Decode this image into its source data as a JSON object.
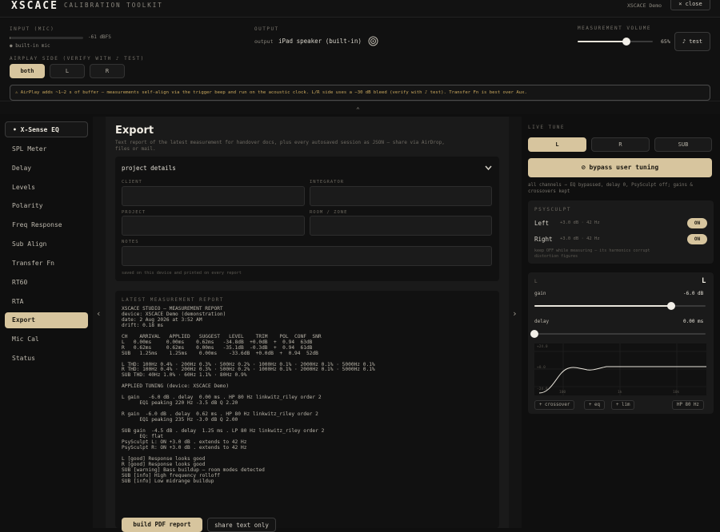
{
  "topbar": {
    "logo": "XSCACE",
    "app_title": "CALIBRATION TOOLKIT",
    "device": "XSCACE Demo",
    "close_label": "× close"
  },
  "input": {
    "label": "INPUT (MIC)",
    "level": "-61 dBFS",
    "level_fraction": 0.01,
    "source": "● built-in mic"
  },
  "output": {
    "label": "OUTPUT",
    "prefix": "output",
    "device": "iPad speaker (built-in)"
  },
  "volume": {
    "label": "MEASUREMENT VOLUME",
    "value": "65%",
    "fraction": 0.65,
    "test_label": "♪ test"
  },
  "airplay": {
    "label": "AIRPLAY SIDE (VERIFY WITH ♪ TEST)",
    "options": [
      "both",
      "L",
      "R"
    ],
    "selected": "both"
  },
  "banner": "⚠ AirPlay adds ~1–2 s of buffer — measurements self-align via the trigger beep and run on the acoustic clock. L/R side uses a −30 dB bleed (verify with ♪ test). Transfer Fn is best over Aux.",
  "sidebar": {
    "items": [
      {
        "label": "• X-Sense EQ"
      },
      {
        "label": "SPL Meter"
      },
      {
        "label": "Delay"
      },
      {
        "label": "Levels"
      },
      {
        "label": "Polarity"
      },
      {
        "label": "Freq Response"
      },
      {
        "label": "Sub Align"
      },
      {
        "label": "Transfer Fn"
      },
      {
        "label": "RT60"
      },
      {
        "label": "RTA"
      },
      {
        "label": "Export"
      },
      {
        "label": "Mic Cal"
      },
      {
        "label": "Status"
      }
    ],
    "selected": "Export"
  },
  "export": {
    "title": "Export",
    "description_line1": "Text report of the latest measurement for handover docs, plus every autosaved session as JSON — share via AirDrop,",
    "description_line2": "files or mail.",
    "project": {
      "title": "project details",
      "client_label": "CLIENT",
      "integrator_label": "INTEGRATOR",
      "project_label": "PROJECT",
      "room_label": "ROOM / ZONE",
      "notes_label": "NOTES",
      "footer": "saved on this device and printed on every report"
    },
    "report_label": "LATEST MEASUREMENT REPORT",
    "report_lines": [
      "XSCACE STUDIO — MEASUREMENT REPORT",
      "device: XSCACE Demo (demonstration)",
      "date: 2 Aug 2026 at 3:52 AM",
      "drift: 0.18 ms",
      "",
      "CH    ARRIVAL   APPLIED   SUGGEST   LEVEL    TRIM    POL  CONF  SNR",
      "L   0.00ms     0.00ms    0.62ms   -34.8dB  +0.0dB  +  0.94  63dB",
      "R   0.62ms     0.62ms    0.00ms   -35.1dB  -0.3dB  +  0.94  61dB",
      "SUB   1.25ms    1.25ms    0.00ms    -33.6dB  +0.0dB  +  0.94  52dB",
      "",
      "L THD: 100Hz 0.4% · 200Hz 0.3% · 500Hz 0.2% · 1000Hz 0.1% · 2000Hz 0.1% · 5000Hz 0.1%",
      "R THD: 100Hz 0.4% · 200Hz 0.3% · 500Hz 0.2% · 1000Hz 0.1% · 2000Hz 0.1% · 5000Hz 0.1%",
      "SUB THD: 40Hz 1.0% · 60Hz 1.1% · 80Hz 0.9%",
      "",
      "APPLIED TUNING (device: XSCACE Demo)",
      "",
      "L gain   -6.0 dB . delay  0.00 ms . HP 80 Hz linkwitz_riley order 2",
      "      EQ1 peaking 220 Hz -3.5 dB Q 2.20",
      "",
      "R gain  -6.0 dB . delay  0.62 ms . HP 80 Hz linkwitz_riley order 2",
      "      EQ1 peaking 235 Hz -3.0 dB Q 2.00",
      "",
      "SUB gain  -4.5 dB . delay  1.25 ms . LP 80 Hz linkwitz_riley order 2",
      "      EQ: flat",
      "PsySculpt L: ON +3.0 dB . extends to 42 Hz",
      "PsySculpt R: ON +3.0 dB . extends to 42 Hz",
      "",
      "L [good] Response looks good",
      "R [good] Response looks good",
      "SUB [warning] Bass buildup — room modes detected",
      "SUB [info] High frequency rolloff",
      "SUB [info] Low midrange buildup"
    ],
    "build_pdf_label": "build PDF report",
    "share_text_label": "share text only"
  },
  "live_tune": {
    "label": "LIVE TUNE",
    "tabs": [
      "L",
      "R",
      "SUB"
    ],
    "selected": "L",
    "bypass_label": "⊘ bypass user tuning",
    "bypass_note_line1": "all channels → EQ bypassed, delay 0, PsySculpt off; gains &",
    "bypass_note_line2": "crossovers kept",
    "psysculpt": {
      "label": "PSYSCULPT",
      "left_label": "Left",
      "left_detail": "+3.0 dB · 42 Hz",
      "left_state": "ON",
      "right_label": "Right",
      "right_detail": "+3.0 dB · 42 Hz",
      "right_state": "ON",
      "note_line1": "keep OFF while measuring — its harmonics corrupt",
      "note_line2": "distortion figures"
    },
    "channel": {
      "label": "L",
      "badge": "L",
      "gain_label": "gain",
      "gain_value": "-6.0 dB",
      "gain_fraction": 0.8,
      "delay_label": "delay",
      "delay_value": "0.00 ms",
      "delay_fraction": 0.0,
      "graph": {
        "y_labels": [
          "+24.0",
          "+0.0",
          "-24.0"
        ],
        "x_labels": [
          "100",
          "1k",
          "10k"
        ]
      },
      "chips": [
        "+ crossover",
        "+ eq",
        "+ lim"
      ],
      "hp_label": "HP 80 Hz"
    }
  },
  "colors": {
    "accent": "#d7c59e",
    "warning": "#c9a85e",
    "background": "#0f0f0f"
  }
}
